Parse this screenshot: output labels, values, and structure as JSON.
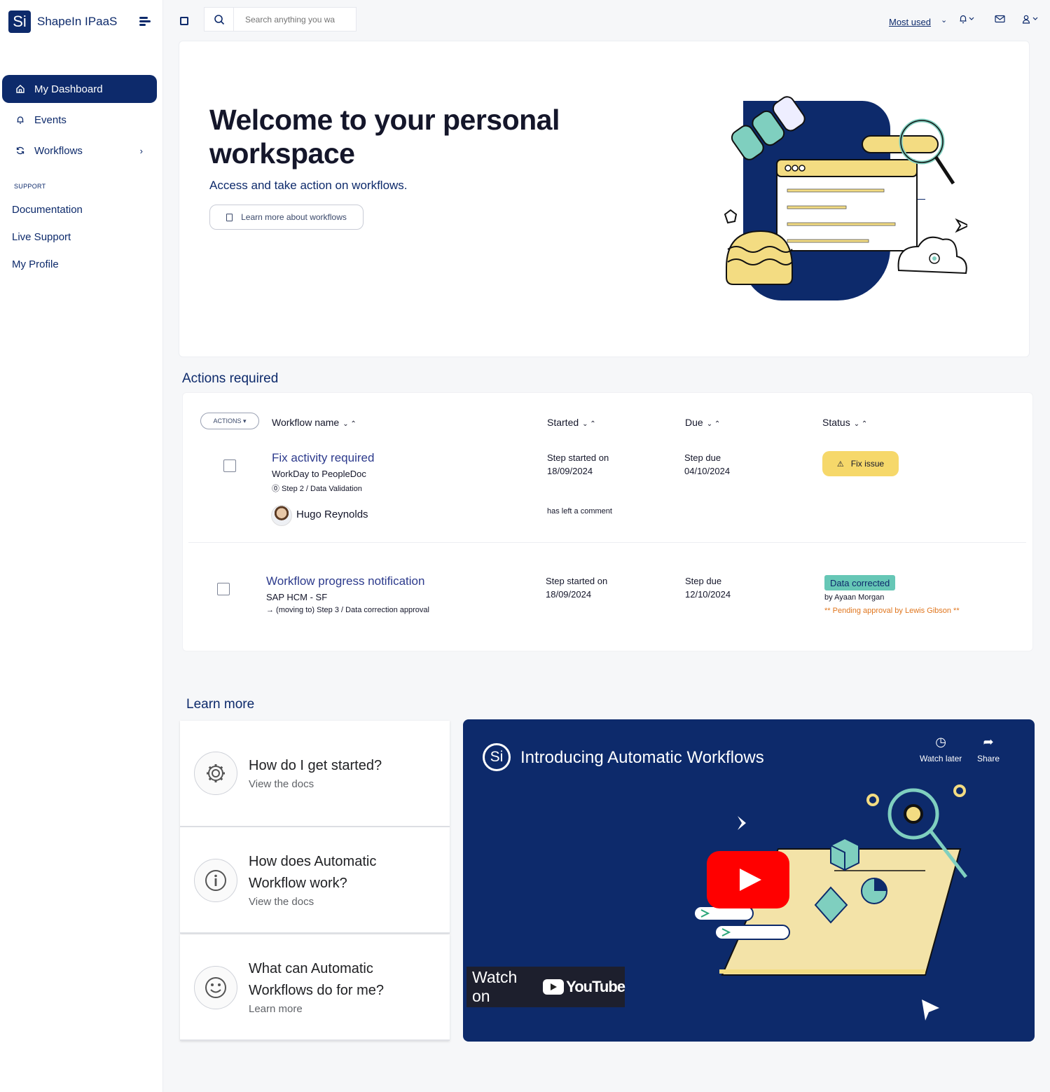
{
  "app": {
    "logo_text": "Si",
    "name": "ShapeIn IPaaS"
  },
  "sidebar": {
    "items": [
      {
        "label": "My Dashboard",
        "icon": "home-icon",
        "active": true
      },
      {
        "label": "Events",
        "icon": "bell-icon"
      },
      {
        "label": "Workflows",
        "icon": "refresh-icon",
        "has_chevron": true
      }
    ],
    "support_label": "SUPPORT",
    "support_links": [
      "Documentation",
      "Live Support",
      "My Profile"
    ]
  },
  "topbar": {
    "search_placeholder": "Search anything you wa",
    "most_used_label": "Most used",
    "icons": [
      "expand-icon",
      "search-icon",
      "bell-icon",
      "mail-icon",
      "user-icon"
    ]
  },
  "welcome": {
    "title": "Welcome to your personal workspace",
    "subtitle": "Access and take action on workflows.",
    "button_label": "Learn more about workflows"
  },
  "actions": {
    "section_title": "Actions required",
    "dropdown_label": "ACTIONS ▾",
    "columns": [
      "Workflow name",
      "Started",
      "Due",
      "Status"
    ],
    "rows": [
      {
        "title": "Fix activity required",
        "subtitle": "WorkDay to PeopleDoc",
        "step": "⓪ Step 2 / Data Validation",
        "started_label": "Step started on",
        "started_date": "18/09/2024",
        "due_label": "Step due",
        "due_date": "04/10/2024",
        "status_button": "Fix issue",
        "person": "Hugo Reynolds",
        "comment": "has left a comment"
      },
      {
        "title": "Workflow progress notification",
        "subtitle": "SAP HCM - SF",
        "step": "→ (moving to) Step 3 / Data correction approval",
        "started_label": "Step started on",
        "started_date": "18/09/2024",
        "due_label": "Step due",
        "due_date": "12/10/2024",
        "status_badge": "Data corrected",
        "status_by": "by Ayaan Morgan",
        "pending": "** Pending approval by Lewis Gibson **"
      }
    ]
  },
  "learn_more": {
    "section_title": "Learn more",
    "cards": [
      {
        "title": "How do I get started?",
        "sub": "View the docs",
        "icon": "gear-icon"
      },
      {
        "title": "How does Automatic Workflow work?",
        "sub": "View the docs",
        "icon": "info-icon"
      },
      {
        "title": "What can Automatic Workflows do for me?",
        "sub": "Learn more",
        "icon": "smiley-icon"
      }
    ]
  },
  "video": {
    "logo_text": "Si",
    "title": "Introducing Automatic Workflows",
    "watch_later": "Watch later",
    "share": "Share",
    "watch_on": "Watch on",
    "youtube": "YouTube"
  },
  "colors": {
    "brand_navy": "#0d2a6b",
    "accent_yellow": "#f6d86a",
    "accent_teal": "#66c7b6",
    "warning_orange": "#e0761e"
  }
}
